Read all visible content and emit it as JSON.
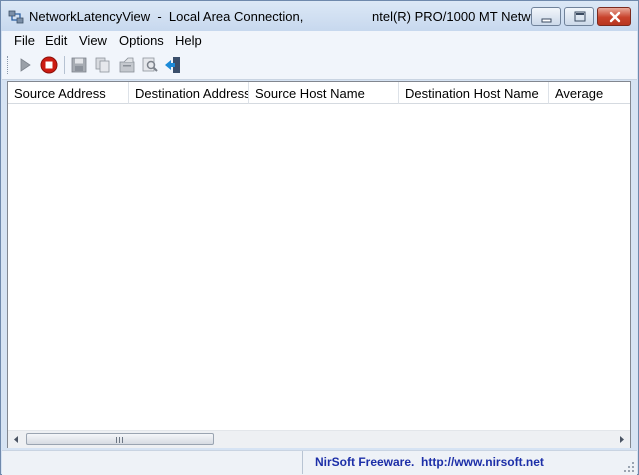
{
  "window": {
    "title_left": "NetworkLatencyView  -  Local Area Connection,",
    "title_right": "ntel(R) PRO/1000 MT Netw..."
  },
  "menu": {
    "items": [
      {
        "label": "File"
      },
      {
        "label": "Edit"
      },
      {
        "label": "View"
      },
      {
        "label": "Options"
      },
      {
        "label": "Help"
      }
    ]
  },
  "toolbar": {
    "icons": [
      "start-icon",
      "stop-icon",
      "save-icon",
      "copy-icon",
      "properties-icon",
      "find-icon",
      "exit-icon"
    ],
    "colors": {
      "stop": "#cc1b12",
      "exit_arrow": "#1c8ad8"
    }
  },
  "list": {
    "columns": [
      "Source Address",
      "Destination Address",
      "Source Host Name",
      "Destination Host Name",
      "Average"
    ],
    "rows": []
  },
  "statusbar": {
    "text": "NirSoft Freeware.  http://www.nirsoft.net"
  }
}
